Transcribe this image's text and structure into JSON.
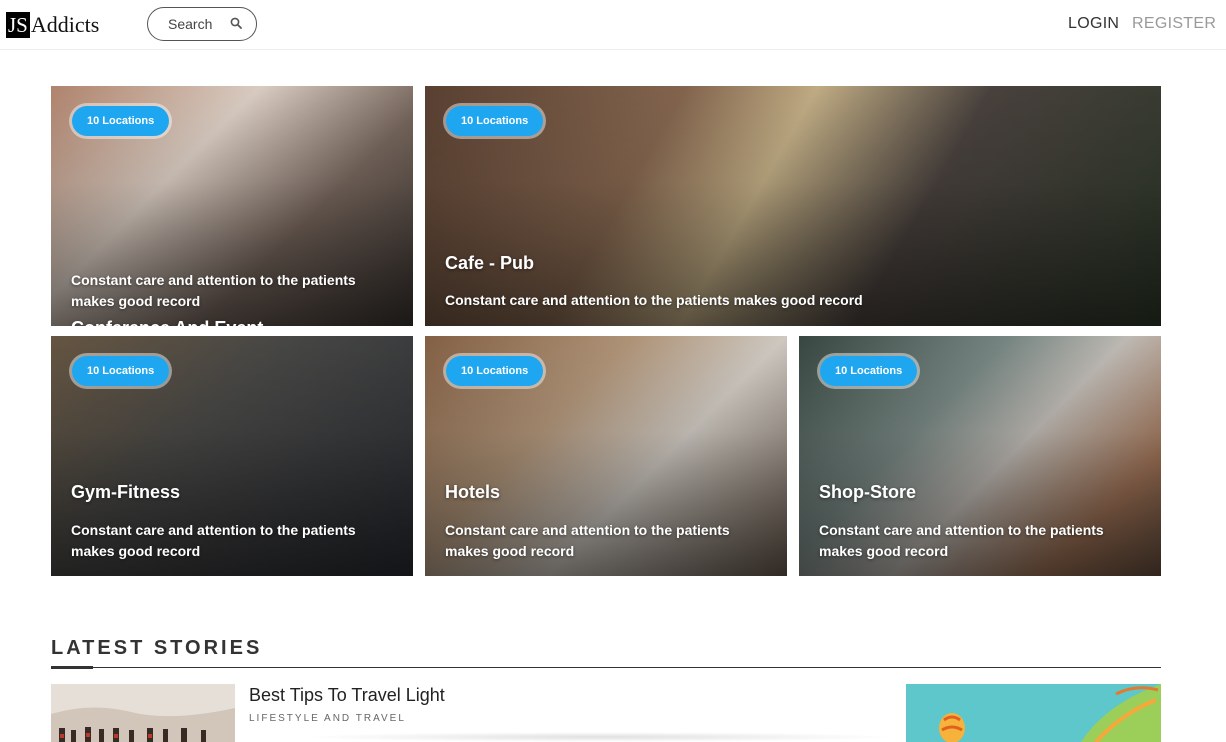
{
  "header": {
    "logo_js": "JS",
    "logo_rest": "Addicts",
    "search_placeholder": "Search",
    "login": "LOGIN",
    "register": "REGISTER"
  },
  "categories": [
    {
      "badge": "10 Locations",
      "title": "Conference And Event",
      "description": "Constant care and attention to the patients makes good record"
    },
    {
      "badge": "10 Locations",
      "title": "Cafe - Pub",
      "description": "Constant care and attention to the patients makes good record"
    },
    {
      "badge": "10 Locations",
      "title": "Gym-Fitness",
      "description": "Constant care and attention to the patients makes good record"
    },
    {
      "badge": "10 Locations",
      "title": "Hotels",
      "description": "Constant care and attention to the patients makes good record"
    },
    {
      "badge": "10 Locations",
      "title": "Shop-Store",
      "description": "Constant care and attention to the patients makes good record"
    }
  ],
  "latest": {
    "heading": "LATEST STORIES",
    "stories": [
      {
        "title": "Best Tips To Travel Light",
        "category": "LIFESTYLE AND TRAVEL"
      }
    ]
  },
  "colors": {
    "badge": "#1ea7f0",
    "register": "#999999"
  }
}
